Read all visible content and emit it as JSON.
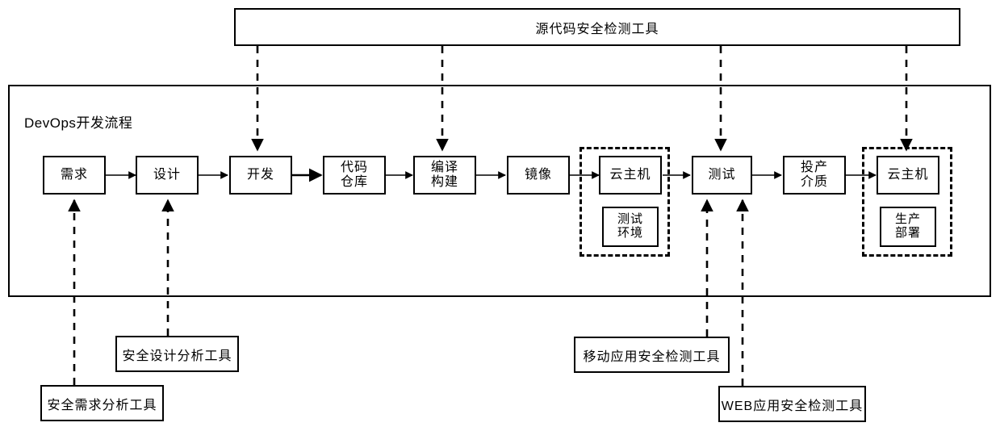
{
  "diagram": {
    "title_top_tool": "源代码安全检测工具",
    "frame_label": "DevOps开发流程",
    "pipeline": [
      {
        "id": "requirement",
        "label": "需求"
      },
      {
        "id": "design",
        "label": "设计"
      },
      {
        "id": "development",
        "label": "开发"
      },
      {
        "id": "code-repository",
        "label": "代码\n仓库"
      },
      {
        "id": "compile-build",
        "label": "编译\n构建"
      },
      {
        "id": "image",
        "label": "镜像"
      },
      {
        "id": "cloud-host-test",
        "label": "云主机"
      },
      {
        "id": "test",
        "label": "测试"
      },
      {
        "id": "release-media",
        "label": "投产\n介质"
      },
      {
        "id": "cloud-host-prod",
        "label": "云主机"
      }
    ],
    "pipeline_flat": {
      "requirement": "需求",
      "design": "设计",
      "development": "开发",
      "code_repository_line1": "代码",
      "code_repository_line2": "仓库",
      "compile_build_line1": "编译",
      "compile_build_line2": "构建",
      "image": "镜像",
      "cloud_host_test": "云主机",
      "test_env_line1": "测试",
      "test_env_line2": "环境",
      "test": "测试",
      "release_media_line1": "投产",
      "release_media_line2": "介质",
      "cloud_host_prod": "云主机",
      "prod_deploy_line1": "生产",
      "prod_deploy_line2": "部署"
    },
    "groups": [
      {
        "id": "test-environment-group",
        "label": "测试环境"
      },
      {
        "id": "production-deployment-group",
        "label": "生产部署"
      }
    ],
    "tools": {
      "source_code": "源代码安全检测工具",
      "security_design": "安全设计分析工具",
      "security_requirement": "安全需求分析工具",
      "mobile_app": "移动应用安全检测工具",
      "web_app": "WEB应用安全检测工具"
    },
    "colors": {
      "stroke": "#000000",
      "background": "#ffffff"
    }
  }
}
